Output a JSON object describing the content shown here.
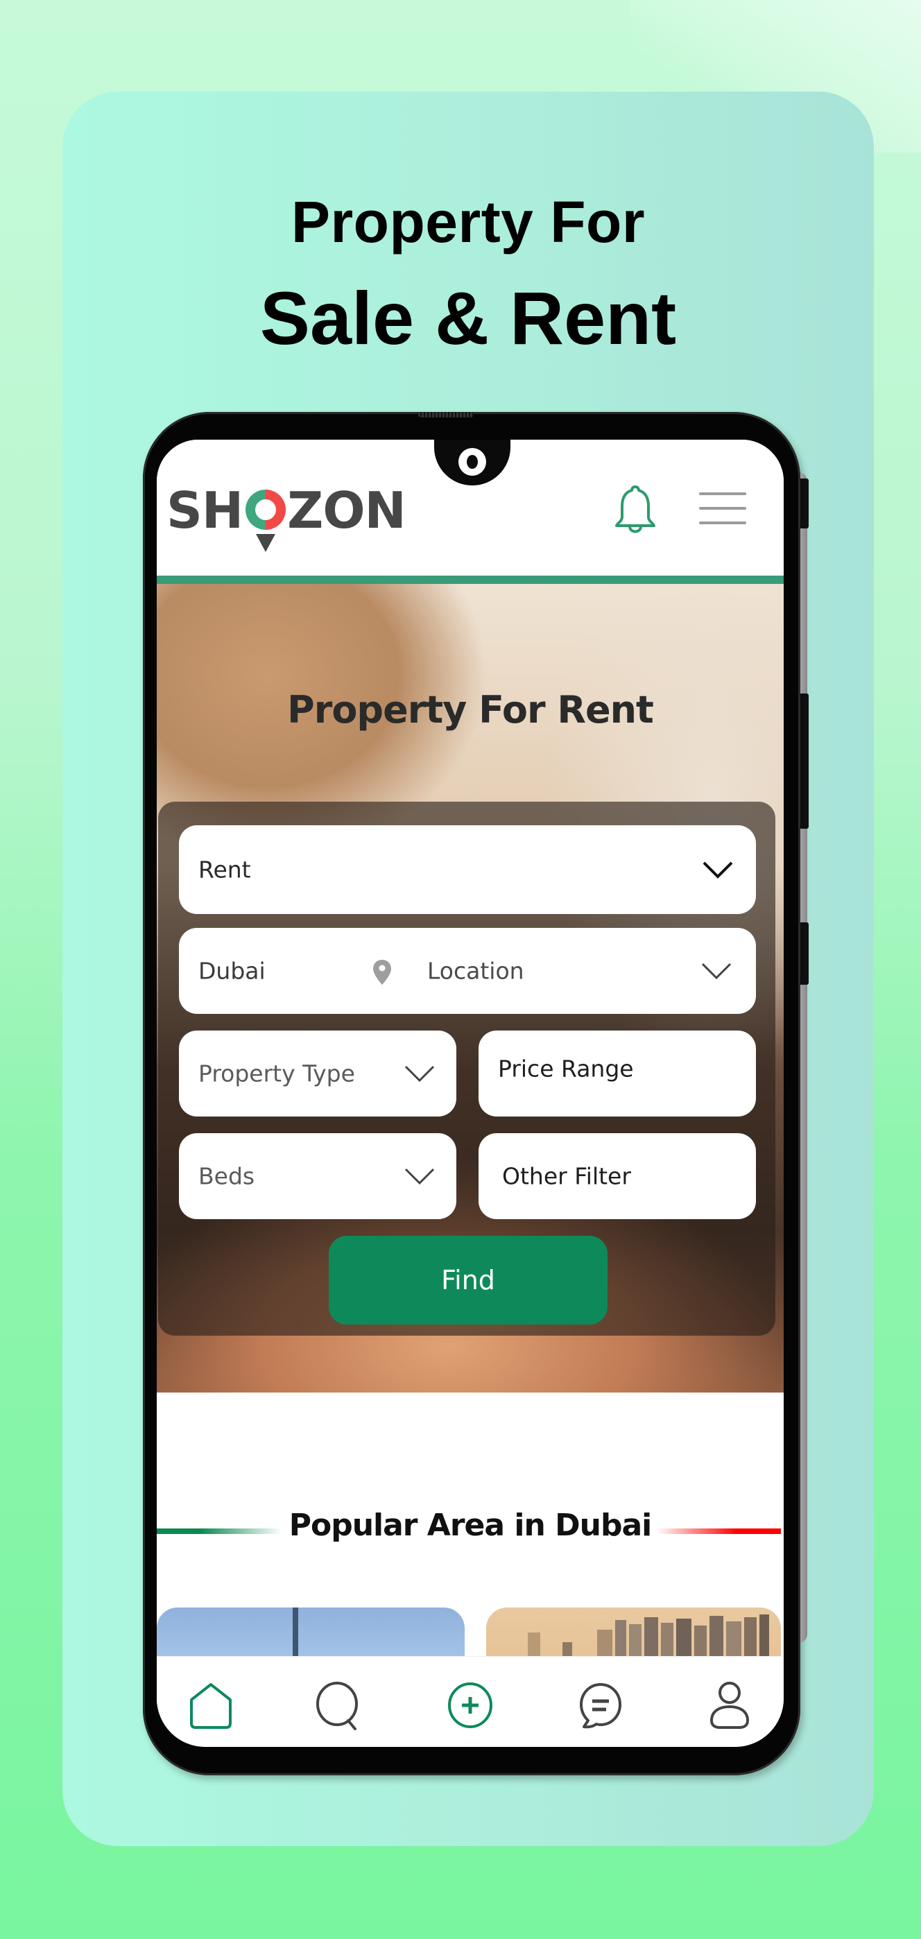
{
  "promo": {
    "headline_line1": "Property For",
    "headline_line2": "Sale & Rent"
  },
  "app": {
    "brand": {
      "name_prefix": "SH",
      "name_suffix": "ZON",
      "full_name": "SHOZON",
      "logo_colors": {
        "left": "#3fa77d",
        "right": "#f14848",
        "text": "#474747"
      }
    },
    "header": {
      "notification_icon": "bell-icon",
      "menu_icon": "hamburger-menu-icon"
    },
    "accent_color": "#0e8a5a",
    "hero": {
      "title": "Property For Rent"
    },
    "search_form": {
      "purpose": {
        "value": "Rent"
      },
      "city": {
        "value": "Dubai"
      },
      "location": {
        "placeholder": "Location"
      },
      "property_type": {
        "placeholder": "Property Type"
      },
      "price_range": {
        "placeholder": "Price Range"
      },
      "beds": {
        "placeholder": "Beds"
      },
      "other_filter": {
        "label": "Other Filter"
      },
      "find_button": "Find"
    },
    "popular": {
      "title": "Popular Area in Dubai",
      "deco_left_color": "#0d8a53",
      "deco_right_color": "#ff0000"
    },
    "bottom_nav": {
      "items": [
        {
          "name": "home",
          "icon": "home-icon",
          "active": true
        },
        {
          "name": "search",
          "icon": "search-icon",
          "active": false
        },
        {
          "name": "add",
          "icon": "add-circle-icon",
          "active": false
        },
        {
          "name": "messages",
          "icon": "chat-icon",
          "active": false
        },
        {
          "name": "profile",
          "icon": "user-icon",
          "active": false
        }
      ]
    }
  }
}
